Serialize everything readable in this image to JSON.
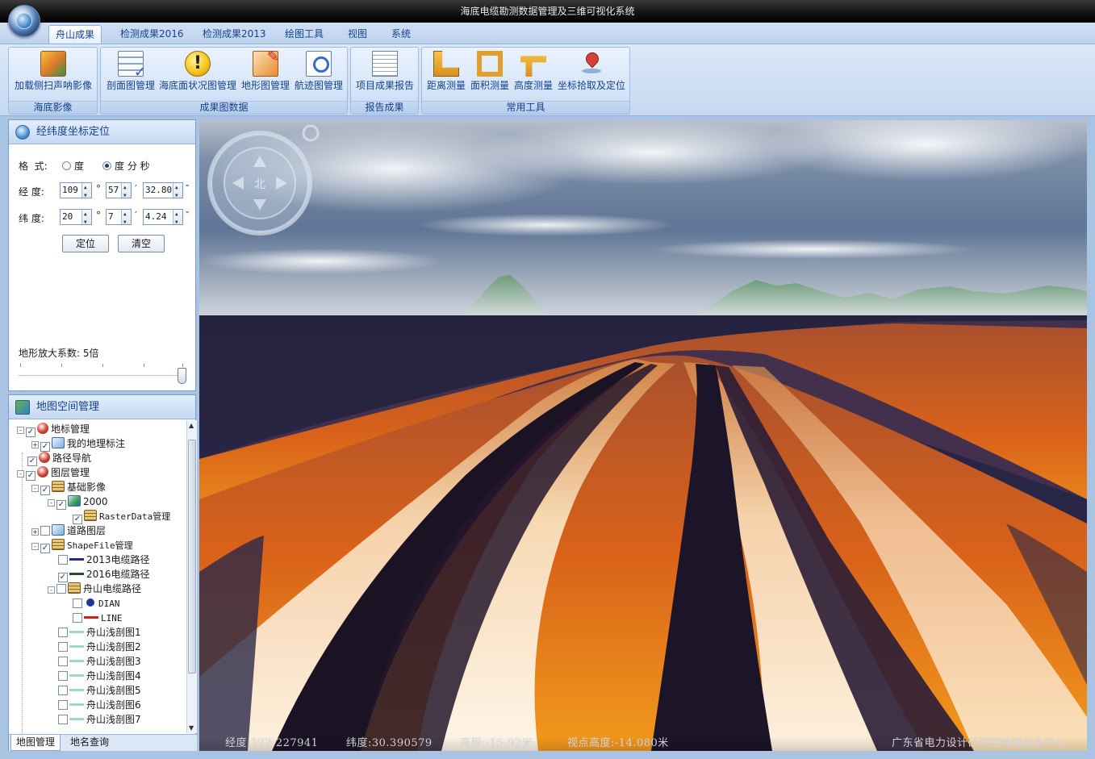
{
  "window": {
    "title": "海底电缆勘测数据管理及三维可视化系统"
  },
  "ribbon": {
    "tabs": [
      {
        "label": "舟山成果",
        "active": true
      },
      {
        "label": "检测成果2016"
      },
      {
        "label": "检测成果2013"
      },
      {
        "label": "绘图工具"
      },
      {
        "label": "视图"
      },
      {
        "label": "系统"
      }
    ],
    "groups": [
      {
        "label": "海底影像",
        "buttons": [
          {
            "label": "加载侧扫声呐影像",
            "icon": "sonar-image-icon"
          }
        ]
      },
      {
        "label": "成果图数据",
        "buttons": [
          {
            "label": "剖面图管理",
            "icon": "section-chart-icon"
          },
          {
            "label": "海底面状况图管理",
            "icon": "warning-icon"
          },
          {
            "label": "地形图管理",
            "icon": "terrain-map-icon"
          },
          {
            "label": "航迹图管理",
            "icon": "track-map-icon"
          }
        ]
      },
      {
        "label": "报告成果",
        "buttons": [
          {
            "label": "项目成果报告",
            "icon": "report-icon"
          }
        ]
      },
      {
        "label": "常用工具",
        "buttons": [
          {
            "label": "距离测量",
            "icon": "ruler-icon"
          },
          {
            "label": "面积测量",
            "icon": "area-measure-icon"
          },
          {
            "label": "高度测量",
            "icon": "height-measure-icon"
          },
          {
            "label": "坐标拾取及定位",
            "icon": "location-pin-icon"
          }
        ]
      }
    ]
  },
  "coord_panel": {
    "title": "经纬度坐标定位",
    "format_label": "格  式:",
    "format_options": [
      {
        "label": "度",
        "selected": false
      },
      {
        "label": "度 分 秒",
        "selected": true
      }
    ],
    "lon_label": "经  度:",
    "lon": {
      "deg": "109",
      "min": "57",
      "sec": "32.80"
    },
    "lat_label": "纬  度:",
    "lat": {
      "deg": "20",
      "min": "7",
      "sec": "4.24"
    },
    "deg_sym": "°",
    "min_sym": "′",
    "sec_sym": "″",
    "locate_button": "定位",
    "clear_button": "清空",
    "terrain_label": "地形放大系数: 5倍",
    "terrain_factor": 5
  },
  "tree_panel": {
    "title": "地图空间管理",
    "nodes": [
      {
        "label": "地标管理",
        "level": 0,
        "expander": "-",
        "checked": true,
        "icon": "globe"
      },
      {
        "label": "我的地理标注",
        "level": 1,
        "expander": "+",
        "checked": true,
        "icon": "road"
      },
      {
        "label": "路径导航",
        "level": 0,
        "expander": "",
        "checked": true,
        "icon": "globe"
      },
      {
        "label": "图层管理",
        "level": 0,
        "expander": "-",
        "checked": true,
        "icon": "globe"
      },
      {
        "label": "基础影像",
        "level": 1,
        "expander": "-",
        "checked": true,
        "icon": "stack"
      },
      {
        "label": "2000",
        "level": 2,
        "expander": "-",
        "checked": true,
        "icon": "raster"
      },
      {
        "label": "RasterData管理",
        "level": 3,
        "expander": "",
        "checked": true,
        "icon": "stack"
      },
      {
        "label": "道路图层",
        "level": 1,
        "expander": "+",
        "checked": false,
        "icon": "road"
      },
      {
        "label": "ShapeFile管理",
        "level": 1,
        "expander": "-",
        "checked": true,
        "icon": "stack"
      },
      {
        "label": "2013电缆路径",
        "level": 2,
        "expander": "",
        "checked": false,
        "icon": "line",
        "color": "#1f2f7a"
      },
      {
        "label": "2016电缆路径",
        "level": 2,
        "expander": "",
        "checked": true,
        "icon": "line",
        "color": "#2b4a2b"
      },
      {
        "label": "舟山电缆路径",
        "level": 2,
        "expander": "-",
        "checked": false,
        "icon": "stack"
      },
      {
        "label": "DIAN",
        "level": 3,
        "expander": "",
        "checked": false,
        "icon": "dot"
      },
      {
        "label": "LINE",
        "level": 3,
        "expander": "",
        "checked": false,
        "icon": "line",
        "color": "#d0221c"
      },
      {
        "label": "舟山浅剖图1",
        "level": 2,
        "expander": "",
        "checked": false,
        "icon": "line",
        "color": "#9fd6cf"
      },
      {
        "label": "舟山浅剖图2",
        "level": 2,
        "expander": "",
        "checked": false,
        "icon": "line",
        "color": "#9fd6cf"
      },
      {
        "label": "舟山浅剖图3",
        "level": 2,
        "expander": "",
        "checked": false,
        "icon": "line",
        "color": "#9fd6cf"
      },
      {
        "label": "舟山浅剖图4",
        "level": 2,
        "expander": "",
        "checked": false,
        "icon": "line",
        "color": "#9fd6cf"
      },
      {
        "label": "舟山浅剖图5",
        "level": 2,
        "expander": "",
        "checked": false,
        "icon": "line",
        "color": "#9fd6cf"
      },
      {
        "label": "舟山浅剖图6",
        "level": 2,
        "expander": "",
        "checked": false,
        "icon": "line",
        "color": "#9fd6cf"
      },
      {
        "label": "舟山浅剖图7",
        "level": 2,
        "expander": "",
        "checked": false,
        "icon": "line",
        "color": "#9fd6cf"
      }
    ],
    "tabs": [
      {
        "label": "地图管理",
        "active": true
      },
      {
        "label": "地名查询"
      }
    ]
  },
  "view3d": {
    "compass_label": "北",
    "status": {
      "lon": "经度:122.227941",
      "lat": "纬度:30.390579",
      "elev": "高程:-15.92米",
      "eye": "视点高度:-14.080米",
      "org": "广东省电力设计研究院地理信息中心"
    }
  }
}
